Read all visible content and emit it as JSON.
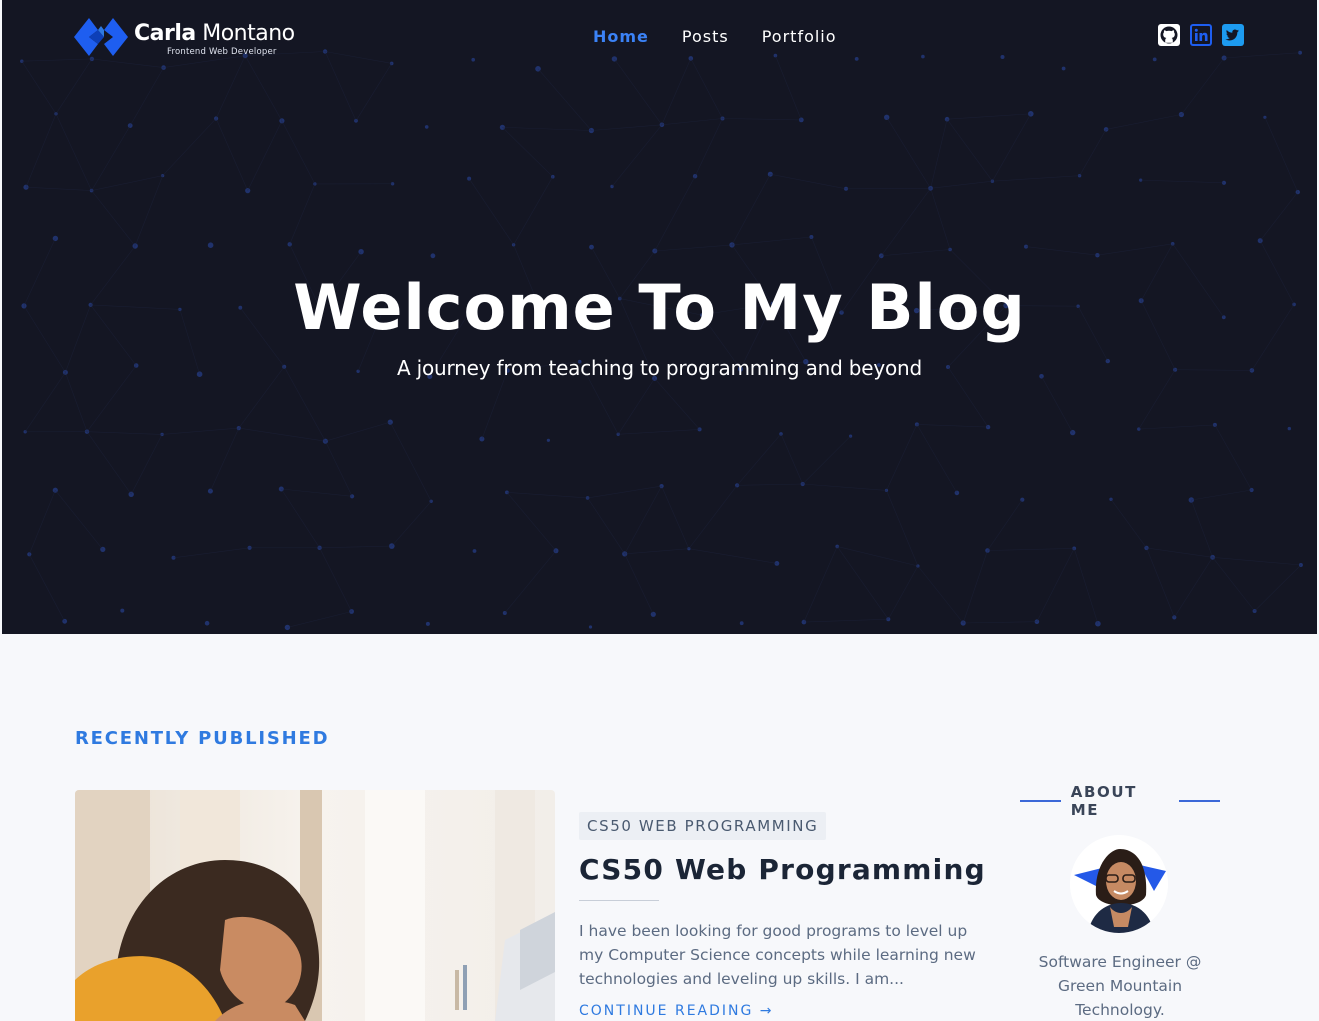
{
  "brand": {
    "first_name": "Carla",
    "last_name": "Montano",
    "tagline": "Frontend Web Developer",
    "logo_icon": "diamond-logo-icon"
  },
  "nav": {
    "items": [
      {
        "label": "Home",
        "active": true
      },
      {
        "label": "Posts",
        "active": false
      },
      {
        "label": "Portfolio",
        "active": false
      }
    ]
  },
  "social": [
    {
      "name": "github-icon"
    },
    {
      "name": "linkedin-icon"
    },
    {
      "name": "twitter-icon"
    }
  ],
  "hero": {
    "title": "Welcome To My Blog",
    "subtitle": "A journey from teaching to programming and beyond"
  },
  "recent": {
    "section_title": "RECENTLY PUBLISHED",
    "post": {
      "tag": "CS50 WEB PROGRAMMING",
      "title": "CS50 Web Programming",
      "excerpt": "I have been looking for good programs to level up my Computer Science concepts while learning new technologies and leveling up skills. I am...",
      "more": "CONTINUE READING →"
    }
  },
  "about": {
    "title": "ABOUT ME",
    "bio": "Software Engineer @ Green Mountain Technology."
  },
  "colors": {
    "accent": "#2f7ae0",
    "hero_bg": "#141623",
    "nav_active": "#3b82f6"
  }
}
